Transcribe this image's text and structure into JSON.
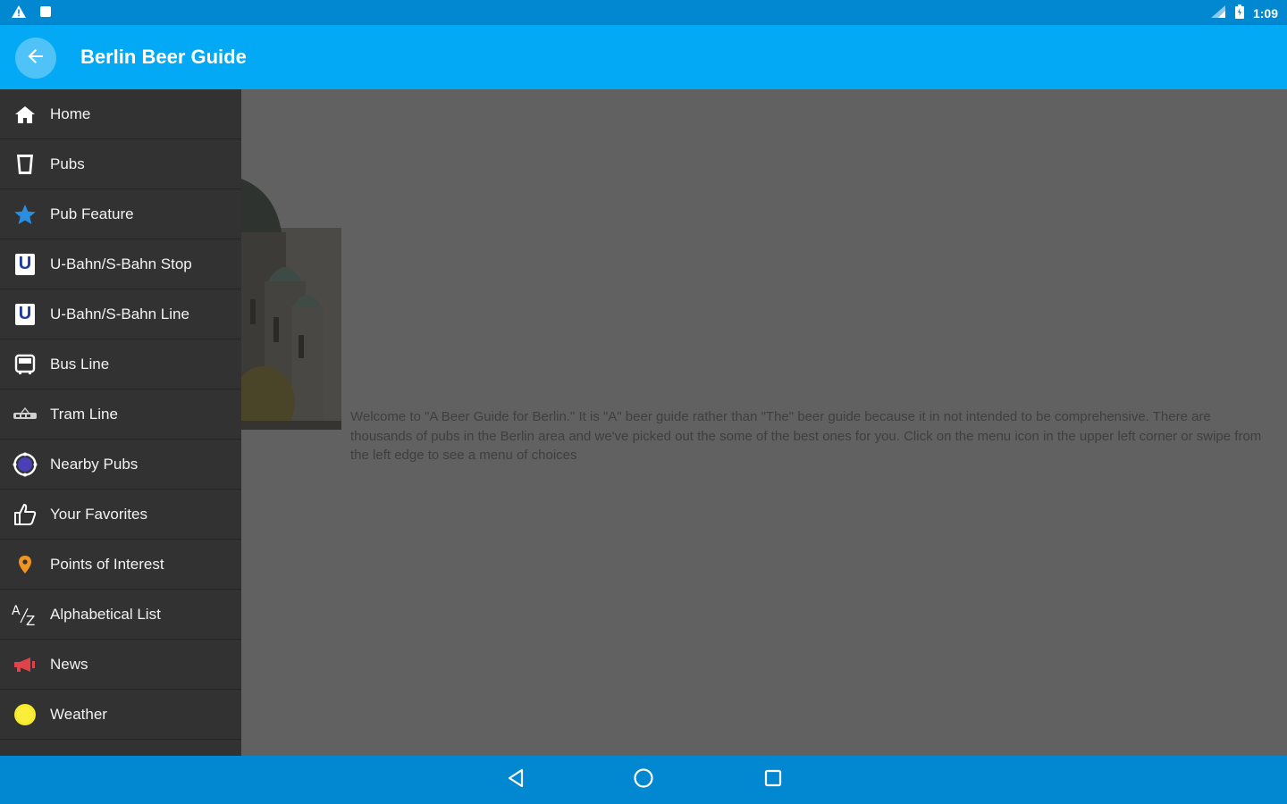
{
  "status_bar": {
    "time": "1:09"
  },
  "app_bar": {
    "title": "Berlin Beer Guide"
  },
  "drawer": {
    "items": [
      {
        "label": "Home",
        "icon": "home-icon"
      },
      {
        "label": "Pubs",
        "icon": "glass-icon"
      },
      {
        "label": "Pub Feature",
        "icon": "star-icon"
      },
      {
        "label": "U-Bahn/S-Bahn Stop",
        "icon": "ubahn-icon"
      },
      {
        "label": "U-Bahn/S-Bahn Line",
        "icon": "ubahn-icon"
      },
      {
        "label": "Bus Line",
        "icon": "bus-icon"
      },
      {
        "label": "Tram Line",
        "icon": "tram-icon"
      },
      {
        "label": "Nearby Pubs",
        "icon": "nearby-icon"
      },
      {
        "label": "Your Favorites",
        "icon": "thumbs-up-icon"
      },
      {
        "label": "Points of Interest",
        "icon": "map-pin-icon"
      },
      {
        "label": "Alphabetical List",
        "icon": "alphabetical-icon"
      },
      {
        "label": "News",
        "icon": "megaphone-icon"
      },
      {
        "label": "Weather",
        "icon": "sun-icon"
      }
    ]
  },
  "content": {
    "intro_text": "Welcome to \"A Beer Guide for Berlin.\" It is \"A\" beer guide rather than \"The\" beer guide because it in not intended to be comprehensive. There are thousands of pubs in the Berlin area and we've picked out the some of the best ones for you. Click on the menu icon in the upper left corner or swipe from the left edge to see a menu of choices"
  },
  "colors": {
    "status_bar": "#0288d1",
    "app_bar": "#03a9f4",
    "drawer_bg": "#323232",
    "scrim": "#616161"
  }
}
